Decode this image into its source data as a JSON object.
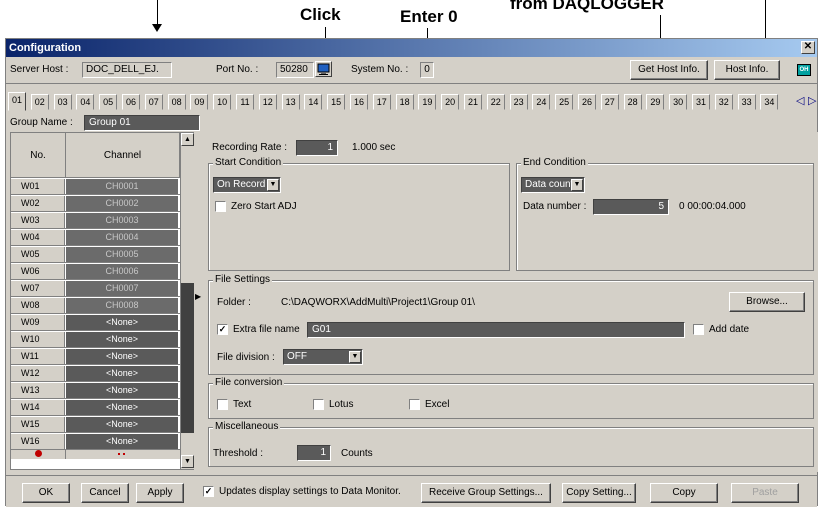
{
  "callouts": {
    "click": "Click",
    "enter_zero": "Enter 0",
    "from_daqlogger": "from DAQLOGGER"
  },
  "window": {
    "title": "Configuration",
    "close_glyph": "✕"
  },
  "server": {
    "host_label": "Server Host :",
    "host_value": "DOC_DELL_EJ.",
    "port_label": "Port No. :",
    "port_value": "50280",
    "system_label": "System No. :",
    "system_value": "0",
    "get_host_info": "Get Host Info.",
    "host_info": "Host Info.",
    "indicator": "OH"
  },
  "tabs": [
    "01",
    "02",
    "03",
    "04",
    "05",
    "06",
    "07",
    "08",
    "09",
    "10",
    "11",
    "12",
    "13",
    "14",
    "15",
    "16",
    "17",
    "18",
    "19",
    "20",
    "21",
    "22",
    "23",
    "24",
    "25",
    "26",
    "27",
    "28",
    "29",
    "30",
    "31",
    "32",
    "33",
    "34"
  ],
  "tab_scroll": {
    "left": "◁",
    "right": "▷"
  },
  "group": {
    "name_label": "Group Name :",
    "name_value": "Group 01"
  },
  "grid": {
    "col_no": "No.",
    "col_channel": "Channel",
    "rows": [
      {
        "no": "W01",
        "channel": "CH0001"
      },
      {
        "no": "W02",
        "channel": "CH0002"
      },
      {
        "no": "W03",
        "channel": "CH0003"
      },
      {
        "no": "W04",
        "channel": "CH0004"
      },
      {
        "no": "W05",
        "channel": "CH0005"
      },
      {
        "no": "W06",
        "channel": "CH0006"
      },
      {
        "no": "W07",
        "channel": "CH0007"
      },
      {
        "no": "W08",
        "channel": "CH0008"
      },
      {
        "no": "W09",
        "channel": "<None>"
      },
      {
        "no": "W10",
        "channel": "<None>"
      },
      {
        "no": "W11",
        "channel": "<None>"
      },
      {
        "no": "W12",
        "channel": "<None>"
      },
      {
        "no": "W13",
        "channel": "<None>"
      },
      {
        "no": "W14",
        "channel": "<None>"
      },
      {
        "no": "W15",
        "channel": "<None>"
      },
      {
        "no": "W16",
        "channel": "<None>"
      }
    ]
  },
  "recording": {
    "label": "Recording Rate :",
    "value": "1",
    "unit": "1.000 sec"
  },
  "start_condition": {
    "title": "Start Condition",
    "mode": "On Record",
    "zero_start": "Zero Start ADJ"
  },
  "end_condition": {
    "title": "End Condition",
    "mode": "Data count",
    "data_number_label": "Data number :",
    "data_number_value": "5",
    "duration": "0 00:00:04.000"
  },
  "file_settings": {
    "title": "File Settings",
    "folder_label": "Folder :",
    "folder_value": "C:\\DAQWORX\\AddMulti\\Project1\\Group 01\\",
    "browse": "Browse...",
    "extra_file_name_label": "Extra file name",
    "extra_file_name_value": "G01",
    "add_date": "Add date",
    "division_label": "File division :",
    "division_value": "OFF"
  },
  "file_conversion": {
    "title": "File conversion",
    "text": "Text",
    "lotus": "Lotus",
    "excel": "Excel"
  },
  "misc": {
    "title": "Miscellaneous",
    "threshold_label": "Threshold :",
    "threshold_value": "1",
    "threshold_unit": "Counts"
  },
  "bottom": {
    "ok": "OK",
    "cancel": "Cancel",
    "apply": "Apply",
    "update_display": "Updates display settings to Data Monitor.",
    "receive_group": "Receive Group Settings...",
    "copy_setting": "Copy Setting...",
    "copy": "Copy",
    "paste": "Paste"
  }
}
